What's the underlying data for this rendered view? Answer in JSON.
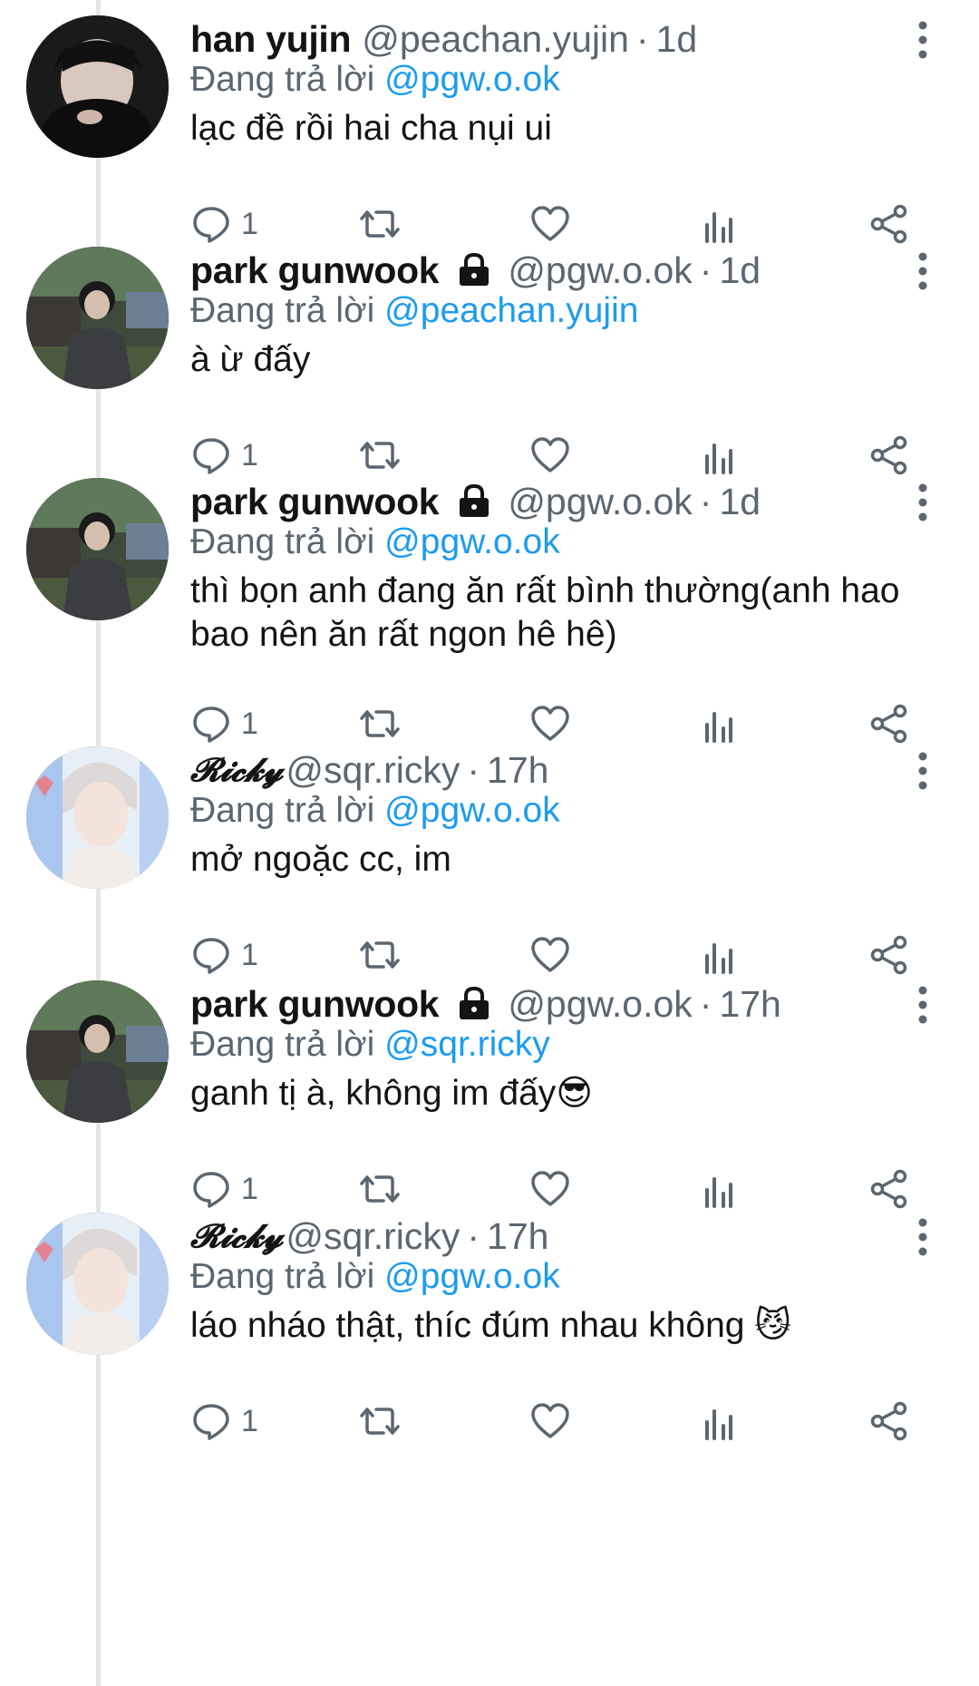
{
  "tweets": [
    {
      "display_name": "han yujin",
      "handle": "@peachan.yujin",
      "separator": "·",
      "time": "1d",
      "reply_prefix": "Đang trả lời",
      "reply_mention": "@pgw.o.ok",
      "text": "lạc đề rồi hai cha nụi ui",
      "reply_count": "1",
      "locked": false,
      "avatar": "avatar-dark-hooded-girl"
    },
    {
      "display_name": "park gunwook",
      "handle": "@pgw.o.ok",
      "separator": "·",
      "time": "1d",
      "reply_prefix": "Đang trả lời",
      "reply_mention": "@peachan.yujin",
      "text": "à ừ đấy",
      "reply_count": "1",
      "locked": true,
      "avatar": "avatar-boy-outdoor"
    },
    {
      "display_name": "park gunwook",
      "handle": "@pgw.o.ok",
      "separator": "·",
      "time": "1d",
      "reply_prefix": "Đang trả lời",
      "reply_mention": "@pgw.o.ok",
      "text": "thì bọn anh đang ăn rất bình thường(anh hao bao nên ăn rất ngon hê hê)",
      "reply_count": "1",
      "locked": true,
      "avatar": "avatar-boy-outdoor"
    },
    {
      "display_name": "𝓡𝓲𝓬𝓴𝔂",
      "handle": "@sqr.ricky",
      "separator": "·",
      "time": "17h",
      "reply_prefix": "Đang trả lời",
      "reply_mention": "@pgw.o.ok",
      "text": "mở ngoặc cc, im",
      "reply_count": "1",
      "locked": false,
      "avatar": "avatar-blond-boy"
    },
    {
      "display_name": "park gunwook",
      "handle": "@pgw.o.ok",
      "separator": "·",
      "time": "17h",
      "reply_prefix": "Đang trả lời",
      "reply_mention": "@sqr.ricky",
      "text": "ganh tị à, không im đấy😎",
      "reply_count": "1",
      "locked": true,
      "avatar": "avatar-boy-outdoor"
    },
    {
      "display_name": "𝓡𝓲𝓬𝓴𝔂",
      "handle": "@sqr.ricky",
      "separator": "·",
      "time": "17h",
      "reply_prefix": "Đang trả lời",
      "reply_mention": "@pgw.o.ok",
      "text": "láo nháo thật, thíc đúm nhau không 😼",
      "reply_count": "1",
      "locked": false,
      "avatar": "avatar-blond-boy"
    }
  ],
  "icons": {
    "reply": "reply-icon",
    "retweet": "retweet-icon",
    "like": "heart-icon",
    "views": "views-icon",
    "share": "share-icon",
    "more": "more-vertical-icon",
    "lock": "lock-icon"
  },
  "colors": {
    "mention": "#1d9bf0",
    "secondary_text": "#5b6670",
    "thread_line": "#e3e6e9",
    "icon": "#5b6670"
  }
}
